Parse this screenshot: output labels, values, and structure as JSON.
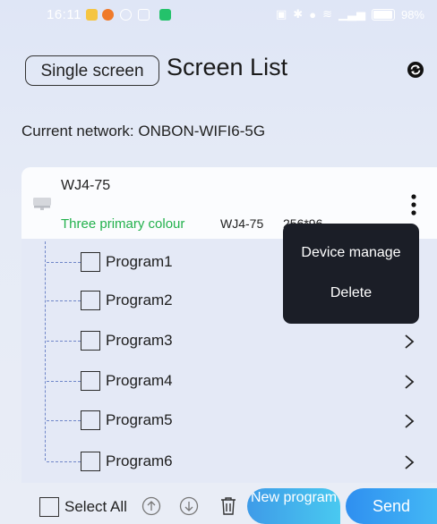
{
  "status_bar": {
    "time": "16:11",
    "battery": "98%",
    "icons": [
      "qq-icon",
      "weibo-icon",
      "notification-icon",
      "app-icon",
      "nfc-icon",
      "bluetooth-icon",
      "location-icon",
      "wifi-icon",
      "signal-icon",
      "battery-icon"
    ]
  },
  "header": {
    "single_screen_label": "Single screen",
    "title": "Screen List",
    "refresh_icon": "refresh-icon"
  },
  "network": {
    "label": "Current network: ONBON-WIFI6-5G"
  },
  "device": {
    "name": "WJ4-75",
    "type": "Three primary colour",
    "model": "WJ4-75",
    "resolution": "256*96"
  },
  "popup": {
    "items": [
      {
        "label": "Device manage"
      },
      {
        "label": "Delete"
      }
    ]
  },
  "programs": [
    {
      "label": "Program1"
    },
    {
      "label": "Program2"
    },
    {
      "label": "Program3"
    },
    {
      "label": "Program4"
    },
    {
      "label": "Program5"
    },
    {
      "label": "Program6"
    }
  ],
  "bottom": {
    "select_all_label": "Select All",
    "new_program_label": "New program",
    "send_label": "Send"
  },
  "colors": {
    "accent": "#2f8ff0",
    "device_type": "#22b14c",
    "popup_bg": "#1b1e27",
    "tree_line": "#6f86c8"
  }
}
